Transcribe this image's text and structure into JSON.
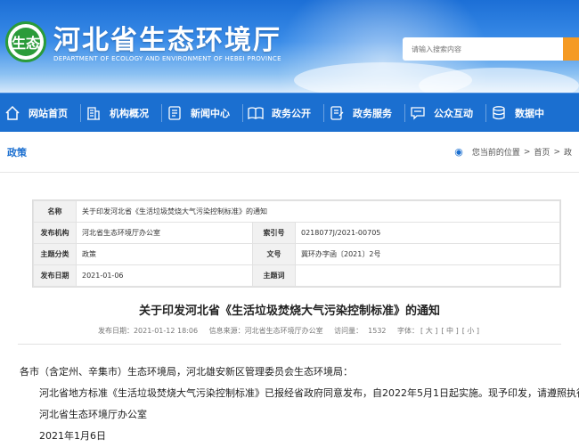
{
  "site": {
    "title": "河北省生态环境厅",
    "subtitle": "DEPARTMENT OF ECOLOGY AND ENVIRONMENT OF HEBEI PROVINCE",
    "logo_text": "生态",
    "search_placeholder": "请输入搜索内容"
  },
  "nav": [
    {
      "label": "网站首页",
      "icon": "home-icon"
    },
    {
      "label": "机构概况",
      "icon": "building-icon"
    },
    {
      "label": "新闻中心",
      "icon": "news-icon"
    },
    {
      "label": "政务公开",
      "icon": "book-icon"
    },
    {
      "label": "政务服务",
      "icon": "service-icon"
    },
    {
      "label": "公众互动",
      "icon": "chat-icon"
    },
    {
      "label": "数据中",
      "icon": "database-icon"
    }
  ],
  "breadcrumb": {
    "column": "政策",
    "prefix": "您当前的位置",
    "items": [
      "首页",
      "政"
    ]
  },
  "meta": {
    "name_label": "名称",
    "name_value": "关于印发河北省《生活垃圾焚烧大气污染控制标准》的通知",
    "issuer_label": "发布机构",
    "issuer_value": "河北省生态环境厅办公室",
    "index_label": "索引号",
    "index_value": "0218077J/2021-00705",
    "category_label": "主题分类",
    "category_value": "政策",
    "docno_label": "文号",
    "docno_value": "冀环办字函〔2021〕2号",
    "date_label": "发布日期",
    "date_value": "2021-01-06",
    "keywords_label": "主题词",
    "keywords_value": ""
  },
  "article": {
    "title": "关于印发河北省《生活垃圾焚烧大气污染控制标准》的通知",
    "publish_time": "发布日期：2021-01-12 18:06",
    "source": "信息来源：河北省生态环境厅办公室",
    "visits_label": "访问量：",
    "visits": "1532",
    "font_label": "字体：",
    "font_large": "[ 大 ]",
    "font_medium": "[ 中 ]",
    "font_small": "[ 小 ]",
    "p1": "各市（含定州、辛集市）生态环境局，河北雄安新区管理委员会生态环境局：",
    "p2": "河北省地方标准《生活垃圾焚烧大气污染控制标准》已报经省政府同意发布，自2022年5月1日起实施。现予印发，请遵照执行。",
    "p3": "河北省生态环境厅办公室",
    "p4": "2021年1月6日"
  }
}
